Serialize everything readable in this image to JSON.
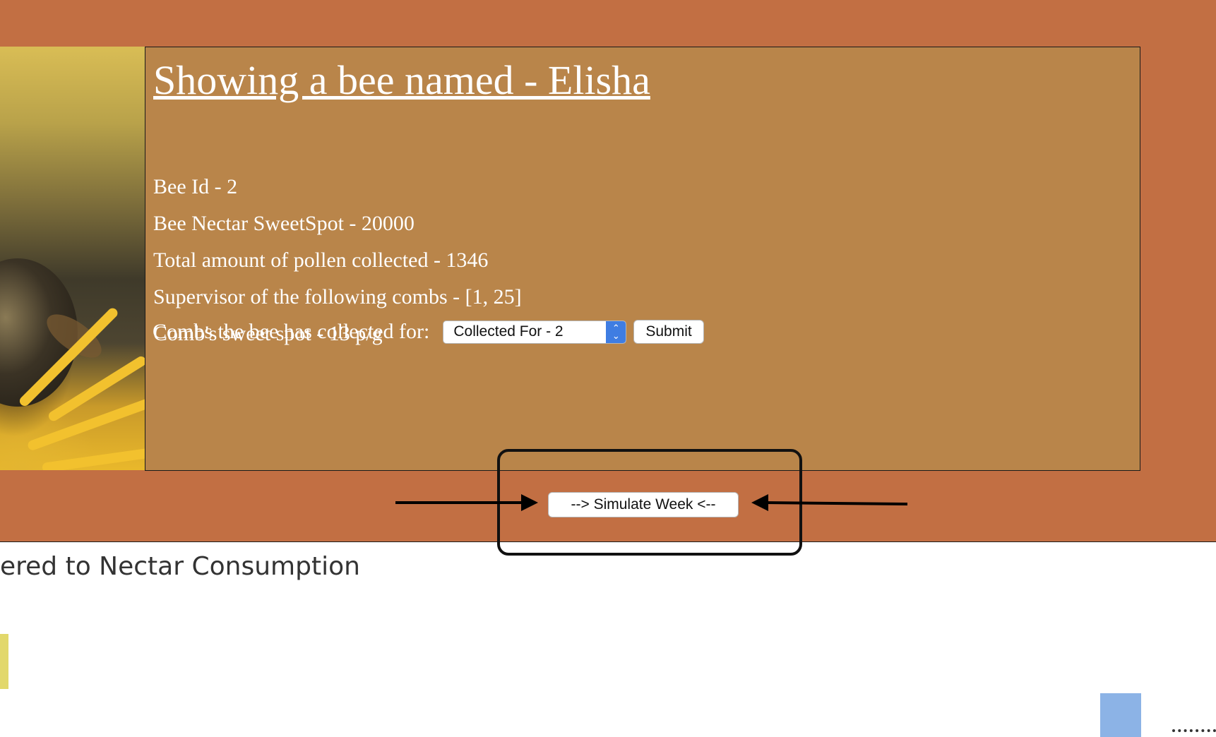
{
  "bee": {
    "title": "Showing a bee named - Elisha",
    "id_line": "Bee Id - 2",
    "sweetspot_line": "Bee Nectar SweetSpot - 20000",
    "pollen_line": "Total amount of pollen collected - 1346",
    "supervisor_line": "Supervisor of the following combs - [1, 25]",
    "comb_sweetspot_line": "Comb's sweet spot - 13 p/g"
  },
  "combs_form": {
    "label": "Combs the bee has collected for:",
    "selected_option": "Collected For - 2",
    "submit_label": "Submit"
  },
  "simulate": {
    "label": "--> Simulate Week <--"
  },
  "chart_section": {
    "subtitle": "ered to Nectar Consumption"
  },
  "colors": {
    "page_band": "#c26f43",
    "info_panel": "#b9854a",
    "select_chevron": "#3f7de2",
    "bar_yellow": "#e2d86b",
    "bar_blue": "#8cb3e6"
  }
}
